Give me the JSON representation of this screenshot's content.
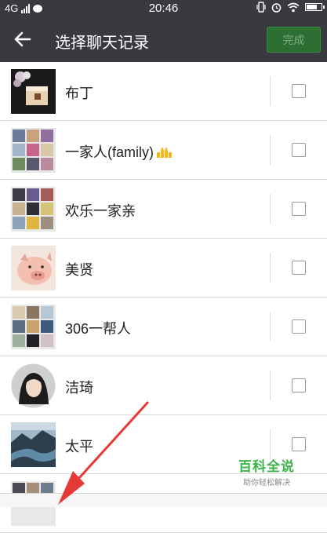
{
  "status": {
    "network": "4G",
    "time": "20:46"
  },
  "header": {
    "title": "选择聊天记录",
    "done_label": "完成"
  },
  "chats": [
    {
      "name": "布丁",
      "avatar": "dessert-photo",
      "checked": false
    },
    {
      "name": "一家人(family)",
      "avatar": "group-grid",
      "checked": false,
      "badge": "crown-icon"
    },
    {
      "name": "欢乐一家亲",
      "avatar": "group-grid",
      "checked": false
    },
    {
      "name": "美贤",
      "avatar": "piglet-photo",
      "checked": false
    },
    {
      "name": "306一帮人",
      "avatar": "group-grid",
      "checked": false
    },
    {
      "name": "洁琦",
      "avatar": "portrait-photo",
      "checked": false
    },
    {
      "name": "太平",
      "avatar": "landscape-photo",
      "checked": false
    }
  ],
  "watermark": {
    "title": "百科全说",
    "subtitle": "助你轻松解决"
  },
  "colors": {
    "header_bg": "#393a3f",
    "done_bg": "#2d6f32",
    "watermark": "#3bb54a",
    "arrow": "#e53935"
  }
}
